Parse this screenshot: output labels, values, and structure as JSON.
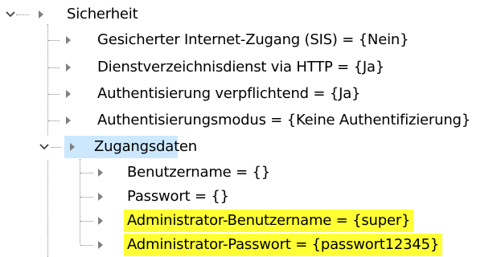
{
  "colors": {
    "selection": "#cce8ff",
    "highlight": "#ffff33",
    "tree_lines": "#8c8c8c",
    "arrow": "#808080"
  },
  "tree": {
    "root": {
      "label": "Sicherheit",
      "expanded": true,
      "children": [
        {
          "label": "Gesicherter Internet-Zugang (SIS) = {Nein}"
        },
        {
          "label": "Dienstverzeichnisdienst via HTTP = {Ja}"
        },
        {
          "label": "Authentisierung verpflichtend = {Ja}"
        },
        {
          "label": "Authentisierungsmodus = {Keine Authentifizierung}"
        },
        {
          "label": "Zugangsdaten",
          "expanded": true,
          "selected": true,
          "children": [
            {
              "label": "Benutzername = {}"
            },
            {
              "label": "Passwort = {}"
            },
            {
              "label": "Administrator-Benutzername = {super}",
              "highlighted": true
            },
            {
              "label": "Administrator-Passwort = {passwort12345}",
              "highlighted": true
            }
          ]
        }
      ]
    }
  }
}
